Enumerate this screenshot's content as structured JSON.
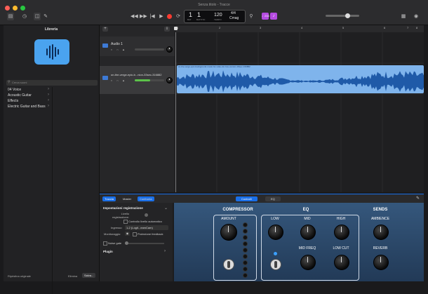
{
  "window": {
    "title": "Senza titolo - Tracce"
  },
  "lcd": {
    "bar": "1",
    "beat": "1",
    "bars_label": "BAT",
    "beat_label": "BATTITO",
    "tempo": "120",
    "tempo_label": "TEMPO",
    "signature": "4/4",
    "key": "Cmag"
  },
  "toolbar": {
    "tuner_badge": "♩234"
  },
  "library": {
    "title": "Libreria",
    "search_placeholder": "Cerca suoni",
    "categories": [
      "04 Voice",
      "Acoustic Guitar",
      "Effects",
      "Electric Guitar and Bass"
    ],
    "footer_buttons": [
      "Ripristina originale",
      "Elimina",
      "Salva..."
    ]
  },
  "tracks": [
    {
      "name": "Audio 1"
    },
    {
      "name": "on-the-verge-epic-b...nion-33sec-316882"
    }
  ],
  "ruler": {
    "marks": [
      "1",
      "2",
      "3",
      "4",
      "5",
      "6",
      "7",
      "8",
      "9"
    ]
  },
  "region": {
    "title": "on-the-verge-epic-background-music-for-video-for-hve-version-33sec-316882"
  },
  "inspector": {
    "tabs": [
      "Traccia",
      "Master",
      "Confronta"
    ],
    "section_title": "Impostazioni registrazione",
    "level_label": "Livello registrazione:",
    "auto_level_label": "Controllo livello automatico",
    "input_label": "Ingresso:",
    "input_value": "1-2 (Logit...eamCam)",
    "monitor_label": "Monitoraggio:",
    "feedback_label": "Protezione feedback",
    "noise_gate_label": "Noise gate",
    "plugin_label": "Plugin"
  },
  "smart_controls": {
    "tabs": [
      "Controlli",
      "EQ"
    ],
    "compressor": {
      "title": "COMPRESSOR",
      "amount_label": "AMOUNT"
    },
    "eq": {
      "title": "EQ",
      "low": "LOW",
      "mid": "MID",
      "high": "HIGH",
      "mid_freq": "MID FREQ",
      "low_cut": "LOW CUT"
    },
    "sends": {
      "title": "SENDS",
      "ambience": "AMBIENCE",
      "reverb": "REVERB"
    }
  },
  "colors": {
    "accent": "#1a6fe8",
    "record": "#ff3b30",
    "region": "#7fb4ec",
    "plugin_bg": "#2f4d6e"
  }
}
